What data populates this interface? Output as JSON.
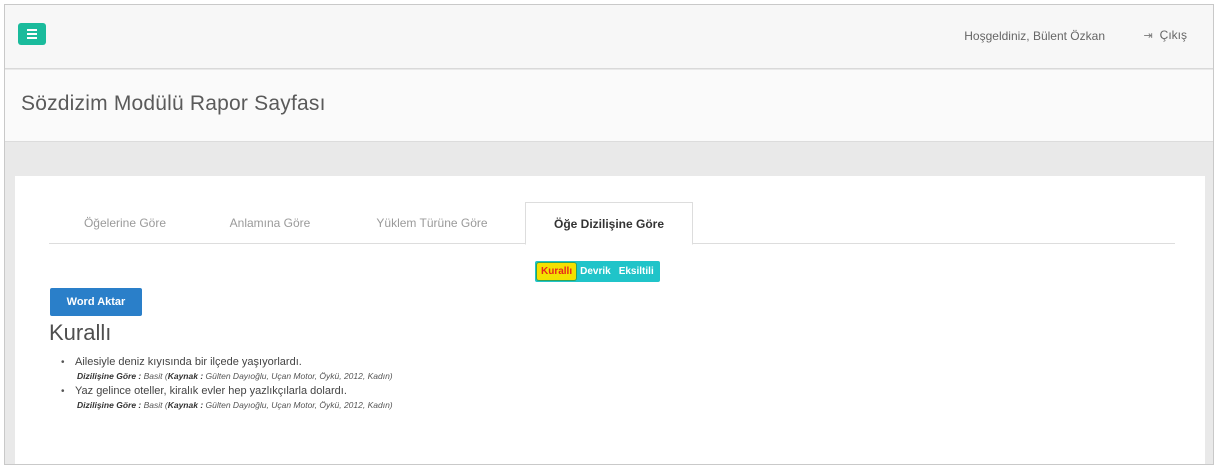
{
  "header": {
    "welcome": "Hoşgeldiniz, Bülent Özkan",
    "logout_label": "Çıkış"
  },
  "page": {
    "title": "Sözdizim Modülü Rapor Sayfası"
  },
  "tabs": [
    {
      "label": "Öğelerine Göre"
    },
    {
      "label": "Anlamına Göre"
    },
    {
      "label": "Yüklem Türüne Göre"
    },
    {
      "label": "Öğe Dizilişine Göre"
    }
  ],
  "filters": [
    {
      "label": "Kurallı"
    },
    {
      "label": "Devrik"
    },
    {
      "label": "Eksiltili"
    }
  ],
  "word_button": "Word Aktar",
  "section_title": "Kurallı",
  "items": [
    {
      "text": "Ailesiyle deniz kıyısında bir ilçede yaşıyorlardı.",
      "label": "Dizilişine Göre :",
      "value": "Basit (",
      "source_label": "Kaynak :",
      "source": "Gülten Dayıoğlu, Uçan Motor, Öykü, 2012, Kadın)"
    },
    {
      "text": "Yaz gelince oteller, kiralık evler hep yazlıkçılarla dolardı.",
      "label": "Dizilişine Göre :",
      "value": "Basit (",
      "source_label": "Kaynak :",
      "source": "Gülten Dayıoğlu, Uçan Motor, Öykü, 2012, Kadın)"
    }
  ]
}
